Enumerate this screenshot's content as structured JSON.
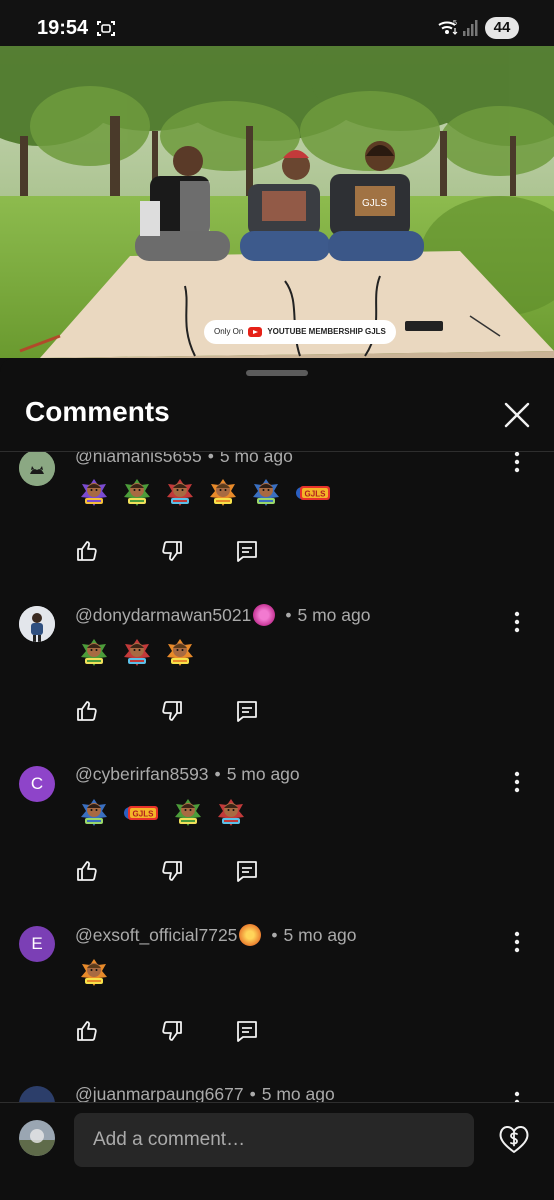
{
  "status_bar": {
    "time": "19:54",
    "battery": "44",
    "network_badge": "5",
    "icons": [
      "screenshot-icon",
      "wifi-icon",
      "signal-icon",
      "battery-icon"
    ]
  },
  "video": {
    "watermark_prefix": "Only On",
    "watermark_label": "YOUTUBE MEMBERSHIP GJLS",
    "shirt_text": "GJLS"
  },
  "sheet": {
    "title": "Comments",
    "close_icon": "close-icon"
  },
  "comments": [
    {
      "author": "@niamanis5655",
      "time": "5 mo ago",
      "has_badge": false,
      "emoji_count": 6
    },
    {
      "author": "@donydarmawan5021",
      "time": "5 mo ago",
      "has_badge": true,
      "emoji_count": 3
    },
    {
      "author": "@cyberirfan8593",
      "time": "5 mo ago",
      "has_badge": false,
      "avatar_letter": "C",
      "emoji_count": 4
    },
    {
      "author": "@exsoft_official7725",
      "time": "5 mo ago",
      "has_badge": true,
      "avatar_letter": "E",
      "emoji_count": 1
    },
    {
      "author": "@juanmarpaung6677",
      "time": "5 mo ago",
      "has_badge": false
    }
  ],
  "separator": "•",
  "emoji_text": "GJLS",
  "add_comment": {
    "placeholder": "Add a comment…"
  },
  "colors": {
    "background": "#0f0f0f",
    "input_bg": "#272727",
    "meta_text": "#aaaaaa",
    "avatar_c": "#8e44c9",
    "avatar_e": "#7b3fb5"
  }
}
